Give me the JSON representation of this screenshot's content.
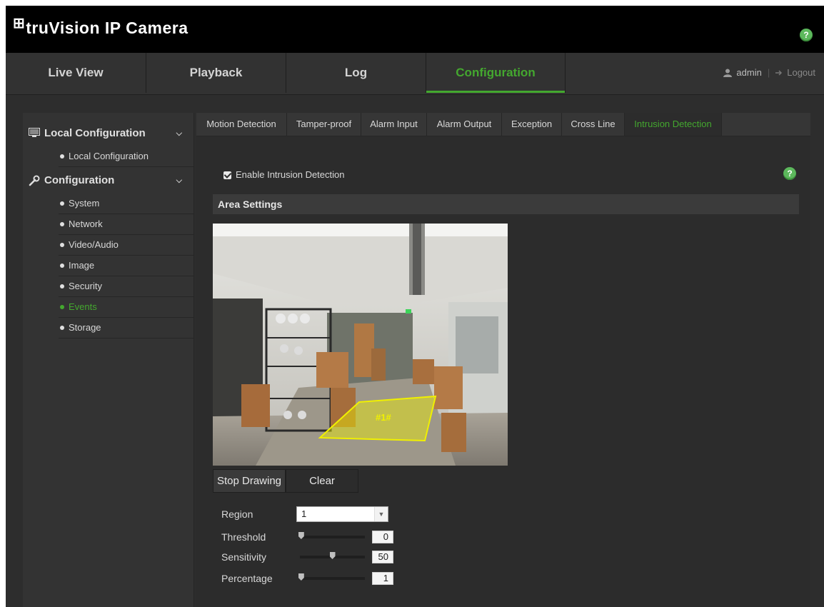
{
  "header": {
    "brand": "truVision IP Camera",
    "help_glyph": "?"
  },
  "nav": {
    "tabs": [
      {
        "label": "Live View"
      },
      {
        "label": "Playback"
      },
      {
        "label": "Log"
      },
      {
        "label": "Configuration",
        "active": true
      }
    ],
    "user": "admin",
    "logout": "Logout"
  },
  "sidebar": {
    "sections": [
      {
        "title": "Local Configuration",
        "icon": "local-config-icon",
        "items": [
          "Local Configuration"
        ]
      },
      {
        "title": "Configuration",
        "icon": "wrench-icon",
        "items": [
          "System",
          "Network",
          "Video/Audio",
          "Image",
          "Security",
          "Events",
          "Storage"
        ],
        "active_item": "Events"
      }
    ]
  },
  "subtabs": [
    "Motion Detection",
    "Tamper-proof",
    "Alarm Input",
    "Alarm Output",
    "Exception",
    "Cross Line",
    "Intrusion Detection"
  ],
  "active_subtab": "Intrusion Detection",
  "form": {
    "enable_label": "Enable Intrusion Detection",
    "enabled": true,
    "area_settings": "Area Settings",
    "region_tag": "#1#",
    "stop_drawing": "Stop Drawing",
    "clear": "Clear",
    "region_label": "Region",
    "region_value": "1",
    "threshold_label": "Threshold",
    "threshold_value": "0",
    "sensitivity_label": "Sensitivity",
    "sensitivity_value": "50",
    "percentage_label": "Percentage",
    "percentage_value": "1"
  },
  "colors": {
    "accent": "#44a82f",
    "help": "#5cb85c",
    "region_outline": "#f0f000"
  }
}
